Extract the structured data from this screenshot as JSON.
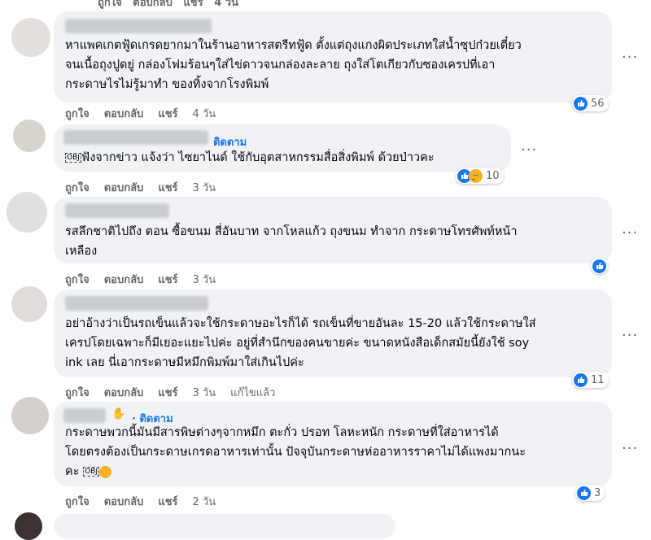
{
  "top_actions": "ถูกใจ   ตอบกลับ   แชร์   4 วัน",
  "action_labels": {
    "like": "ถูกใจ",
    "reply": "ตอบกลับ",
    "share": "แชร์"
  },
  "more_glyph": "···",
  "comments": [
    {
      "lines": [
        "หาแพคเกตฟู้ดเกรดยากมาในร้านอาหารสตรีทฟู้ด ตั้งแต่ถุงแกงผิดประเภทใส่น้ำซุปก๋วยเตี๋ยว",
        "จนเนื้อถุงปูดยู่ กล่องโฟมร้อนๆใส่ไข่ดาวจนกล่องละลาย ถุงใส่โตเกียวกับซองเครปที่เอา",
        "กระดาษไรไม่รู้มาทำ ของทิ้งจากโรงพิมพ์"
      ],
      "time": "4 วัน",
      "reaction_count": "56"
    },
    {
      "follow": "ติดตาม",
      "obj": "OBJ",
      "lines": [
        "ฟังจากข่าว แจ้งว่า ไซยาไนด์ ใช้กับอุตสาหกรรมสื่อสิ่งพิมพ์ ด้วยป่าวคะ"
      ],
      "time": "3 วัน",
      "reaction_count": "10"
    },
    {
      "lines": [
        "รสลึกชาติไปถึง ตอน ซื้อขนม สี่อันบาท จากโหลแก้ว ถุงขนม ทำจาก กระดาษโทรศัพท์หน้า",
        "เหลือง"
      ],
      "time": "3 วัน"
    },
    {
      "lines": [
        "อย่าอ้างว่าเป็นรถเข็นแล้วจะใช้กระดาษอะไรก็ได้ รถเข็นที่ขายอันละ 15-20 แล้วใช้กระดาษใส่",
        "เครปโดยเฉพาะก็มีเยอะแยะไปค่ะ อยู่ที่สำนึกของคนขายค่ะ ขนาดหนังสือเด็กสมัยนี้ยังใช้ soy",
        "ink เลย นี่เอากระดาษมีหมึกพิมพ์มาใส่เกินไปค่ะ"
      ],
      "time": "3 วัน",
      "edited": "แก้ไขแล้ว",
      "reaction_count": "11"
    },
    {
      "follow": "· ติดตาม",
      "lines": [
        "กระดาษพวกนี้มันมีสารพิษต่างๆจากหมึก ตะกั่ว ปรอท โลหะหนัก กระดาษที่ใส่อาหารได้",
        "โดยตรงต้องเป็นกระดาษเกรดอาหารเท่านั้น ปัจจุบันกระดาษห่ออาหารราคาไม่ได้แพงมากนะ",
        "คะ"
      ],
      "obj": "OBJ",
      "time": "2 วัน",
      "reaction_count": "3"
    }
  ]
}
